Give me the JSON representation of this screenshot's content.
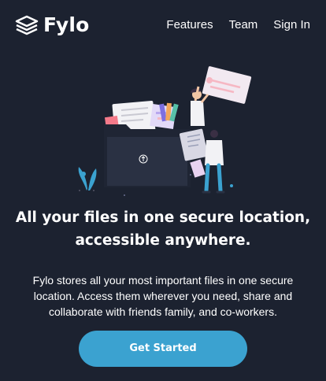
{
  "header": {
    "brand": "Fylo",
    "logo_icon": "stacked-layers-icon",
    "nav": [
      {
        "label": "Features"
      },
      {
        "label": "Team"
      },
      {
        "label": "Sign In"
      }
    ]
  },
  "hero": {
    "illustration": "person-with-folder-and-files-illustration",
    "title": "All your files in one secure location, accessible anywhere.",
    "description": "Fylo stores all your most important files in one secure location. Access them wherever you need, share and collaborate with friends family, and co-workers.",
    "cta_label": "Get Started"
  },
  "colors": {
    "background": "#1c2230",
    "cta": "#3ba2d0",
    "text": "#ffffff"
  }
}
